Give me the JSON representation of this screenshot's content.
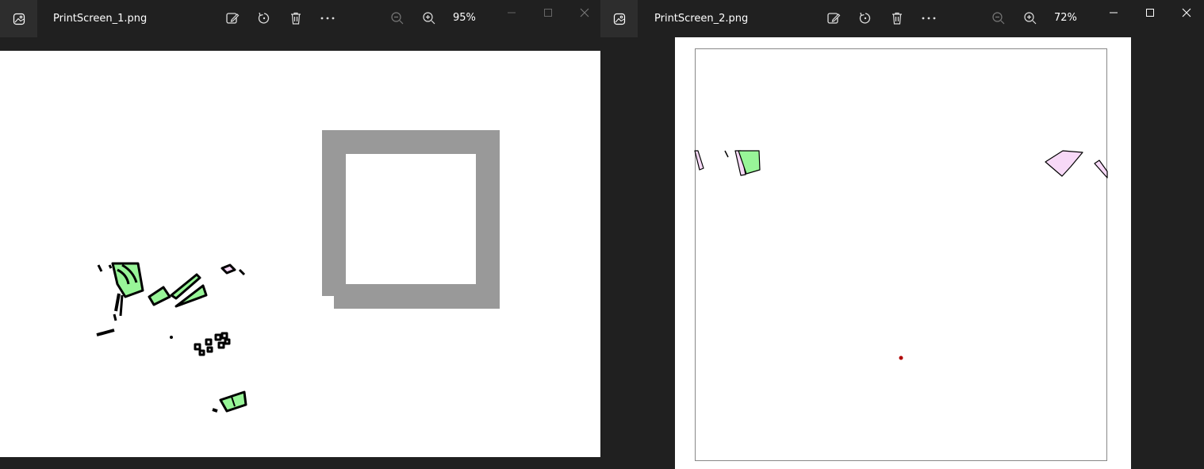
{
  "window1": {
    "filename": "PrintScreen_1.png",
    "zoom": "95%",
    "toolbar": [
      "edit-image-icon",
      "rotate-icon",
      "delete-icon",
      "more-icon"
    ],
    "zoom_controls": [
      "zoom-out-icon",
      "zoom-in-icon"
    ],
    "caption": [
      "minimize-icon",
      "maximize-icon",
      "close-icon"
    ]
  },
  "window2": {
    "filename": "PrintScreen_2.png",
    "zoom": "72%",
    "toolbar": [
      "edit-image-icon",
      "rotate-icon",
      "delete-icon",
      "more-icon"
    ],
    "zoom_controls": [
      "zoom-out-icon",
      "zoom-in-icon"
    ],
    "caption": [
      "minimize-icon",
      "maximize-icon",
      "close-icon"
    ]
  },
  "colors": {
    "chrome": "#202020",
    "canvas": "#ffffff",
    "gray_frame": "#999999",
    "green_fill": "#98f598",
    "pink_fill": "#f7d9f7",
    "red_dot": "#b00000"
  }
}
